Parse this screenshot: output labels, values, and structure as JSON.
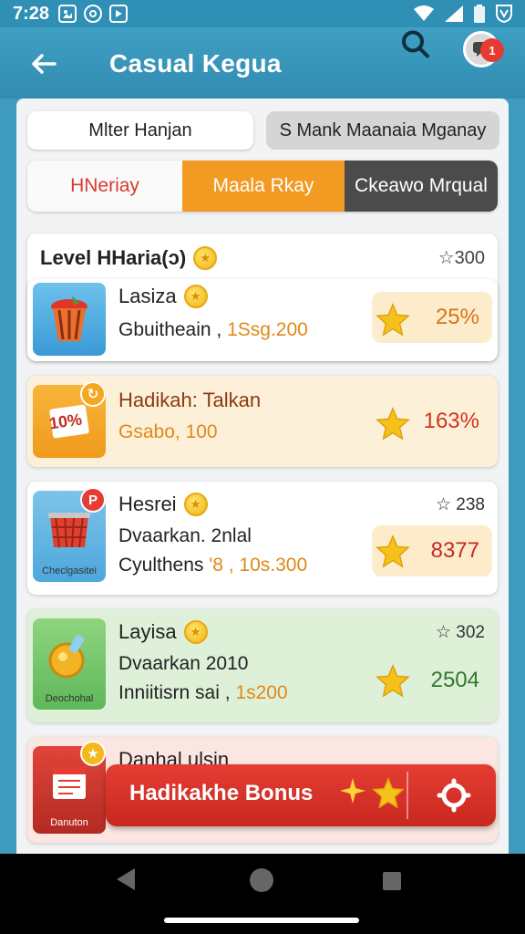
{
  "status_bar": {
    "time": "7:28",
    "left_icons": [
      "image-icon",
      "circle-icon",
      "play-icon"
    ],
    "right_icons": [
      "wifi-icon",
      "signal-icon",
      "battery-icon",
      "shield-icon"
    ]
  },
  "header": {
    "title": "Casual Kegua",
    "notification_count": "1"
  },
  "filters": {
    "pill_left": "Mlter Hanjan",
    "pill_right": "S Mank Maanaia Mganay"
  },
  "tabs": [
    {
      "label": "HNeriay"
    },
    {
      "label": "Maala Rkay"
    },
    {
      "label": "Ckeawo Mrqual"
    }
  ],
  "level": {
    "title": "Level HHaria(ↄ)",
    "value": "☆300"
  },
  "items": [
    {
      "name": "Lasiza",
      "sub_prefix": "Gbuitheain ,",
      "sub_highlight": "1Ssg.200",
      "percent": "25%"
    },
    {
      "name": "Hadikah: Talkan",
      "sub_prefix": "",
      "sub_highlight": "Gsabo, 100",
      "percent": "163%",
      "thumb_label": "10%"
    },
    {
      "name": "Hesrei",
      "right": "☆ 238",
      "sub_line1": "Dvaarkan. 2nlal",
      "sub_prefix": "Cyulthens",
      "sub_highlight": "'8 , 10s.300",
      "percent": "8377",
      "thumb_caption": "Checlgasitei"
    },
    {
      "name": "Layisa",
      "right": "☆ 302",
      "sub_line1": "Dvaarkan  2010",
      "sub_prefix": "Inniitisrn sai ,",
      "sub_highlight": "1s200",
      "percent": "2504",
      "thumb_caption": "Deochohal"
    },
    {
      "name": "Danhal ulsin",
      "thumb_caption": "Danuton"
    }
  ],
  "bonus": {
    "label": "Hadikakhe Bonus"
  },
  "colors": {
    "header": "#3399bd",
    "orange_tab": "#f39a23",
    "dark_tab": "#4b4b4b",
    "red_accent": "#e53d33",
    "gold": "#f5b81c"
  }
}
